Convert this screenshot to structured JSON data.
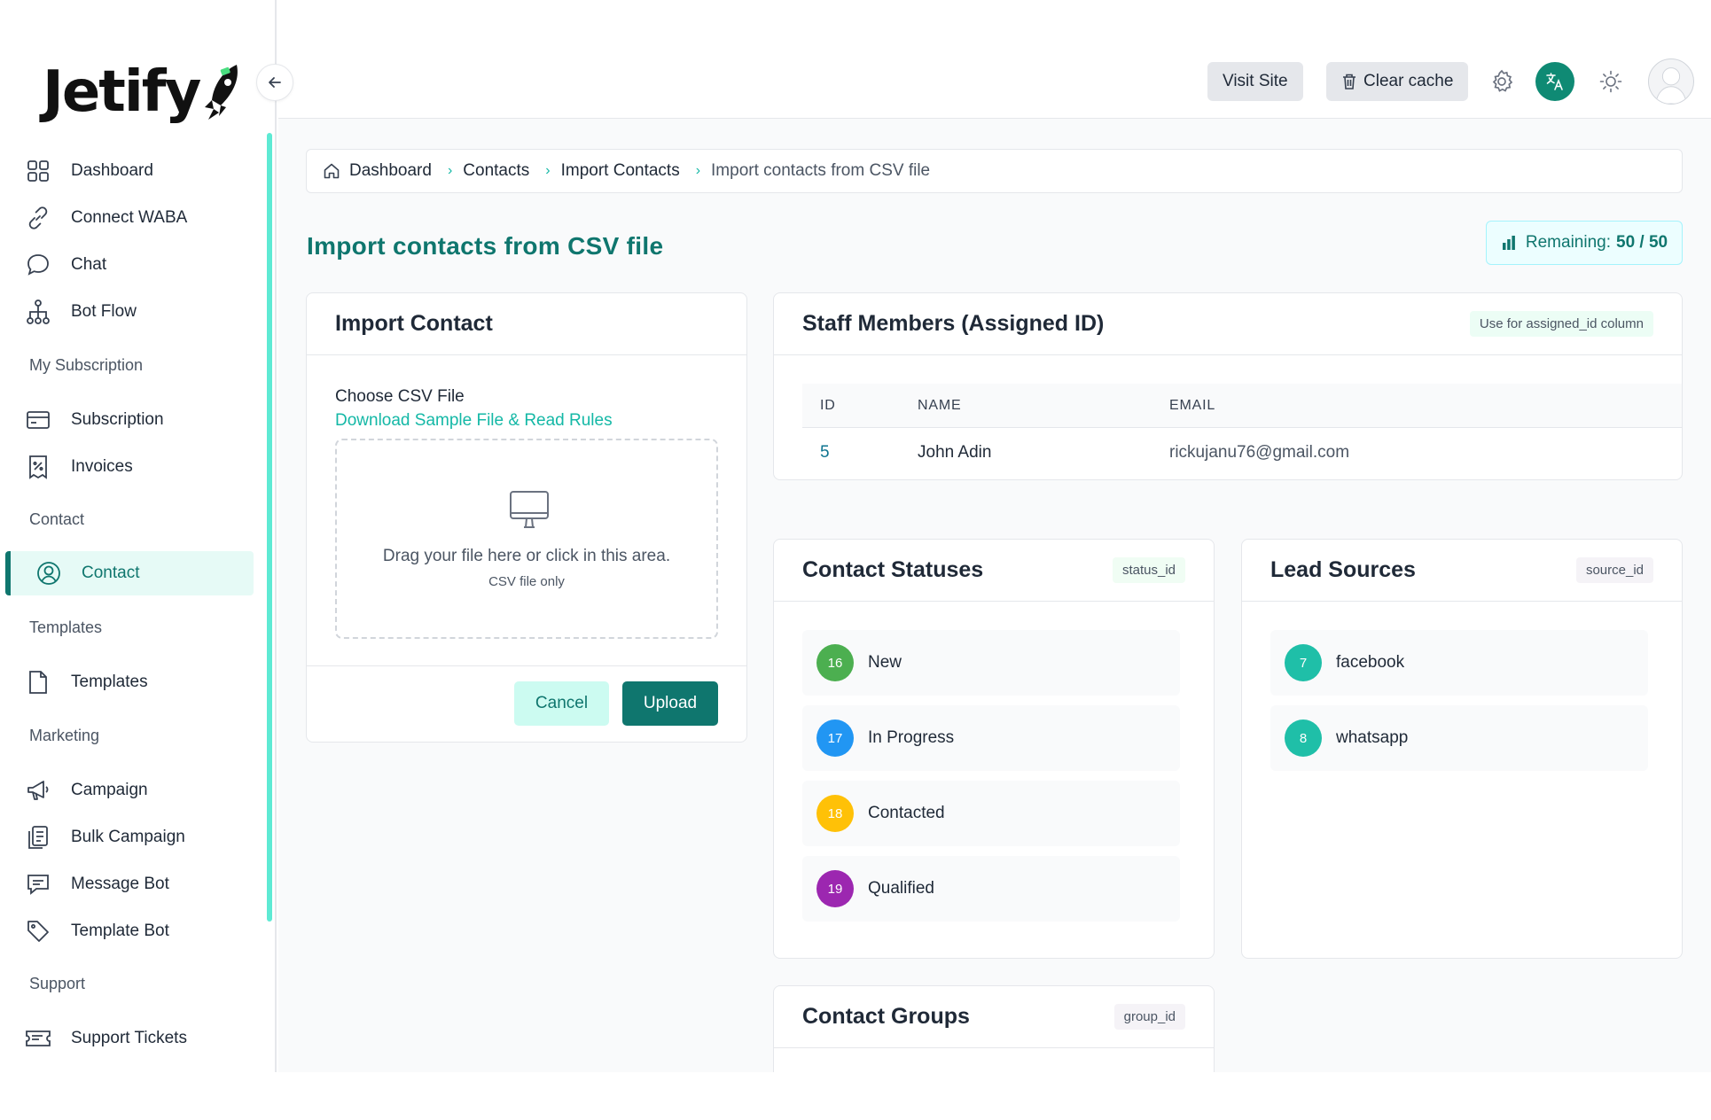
{
  "brand": {
    "logo_text": "Jetify"
  },
  "sidebar": {
    "items": [
      {
        "label": "Dashboard",
        "icon": "grid-icon"
      },
      {
        "label": "Connect WABA",
        "icon": "link-icon"
      },
      {
        "label": "Chat",
        "icon": "chat-bubble-icon"
      },
      {
        "label": "Bot Flow",
        "icon": "flow-tree-icon"
      },
      {
        "label": "Subscription",
        "icon": "credit-card-icon"
      },
      {
        "label": "Invoices",
        "icon": "receipt-icon"
      },
      {
        "label": "Contact",
        "icon": "user-circle-icon",
        "active": true
      },
      {
        "label": "Templates",
        "icon": "document-icon"
      },
      {
        "label": "Campaign",
        "icon": "megaphone-icon"
      },
      {
        "label": "Bulk Campaign",
        "icon": "clipboard-icon"
      },
      {
        "label": "Message Bot",
        "icon": "message-square-icon"
      },
      {
        "label": "Template Bot",
        "icon": "tag-icon"
      },
      {
        "label": "Support Tickets",
        "icon": "ticket-icon"
      }
    ],
    "sections": [
      "My Subscription",
      "Contact",
      "Templates",
      "Marketing",
      "Support"
    ]
  },
  "topbar": {
    "visit_site": "Visit Site",
    "clear_cache": "Clear cache"
  },
  "breadcrumb": [
    "Dashboard",
    "Contacts",
    "Import Contacts",
    "Import contacts from CSV file"
  ],
  "page": {
    "title": "Import contacts from CSV file",
    "remaining_label": "Remaining:",
    "remaining_value": "50 / 50"
  },
  "import_card": {
    "title": "Import Contact",
    "choose_label": "Choose CSV File",
    "download_link": "Download Sample File & Read Rules",
    "drop_text": "Drag your file here or click in this area.",
    "drop_sub": "CSV file only",
    "cancel": "Cancel",
    "upload": "Upload"
  },
  "staff": {
    "title": "Staff Members (Assigned ID)",
    "tag": "Use for assigned_id column",
    "columns": [
      "ID",
      "NAME",
      "EMAIL"
    ],
    "rows": [
      {
        "id": "5",
        "name": "John Adin",
        "email": "rickujanu76@gmail.com"
      }
    ]
  },
  "statuses": {
    "title": "Contact Statuses",
    "tag": "status_id",
    "items": [
      {
        "id": "16",
        "label": "New",
        "color": "#4caf50"
      },
      {
        "id": "17",
        "label": "In Progress",
        "color": "#2196f3"
      },
      {
        "id": "18",
        "label": "Contacted",
        "color": "#ffc107"
      },
      {
        "id": "19",
        "label": "Qualified",
        "color": "#9c27b0"
      }
    ]
  },
  "sources": {
    "title": "Lead Sources",
    "tag": "source_id",
    "items": [
      {
        "id": "7",
        "label": "facebook",
        "color": "#1fbfa8"
      },
      {
        "id": "8",
        "label": "whatsapp",
        "color": "#1fbfa8"
      }
    ]
  },
  "groups": {
    "title": "Contact Groups",
    "tag": "group_id"
  },
  "colors": {
    "accent": "#0f766e",
    "accent_light": "#ccfbf1",
    "link": "#14b8a6"
  }
}
